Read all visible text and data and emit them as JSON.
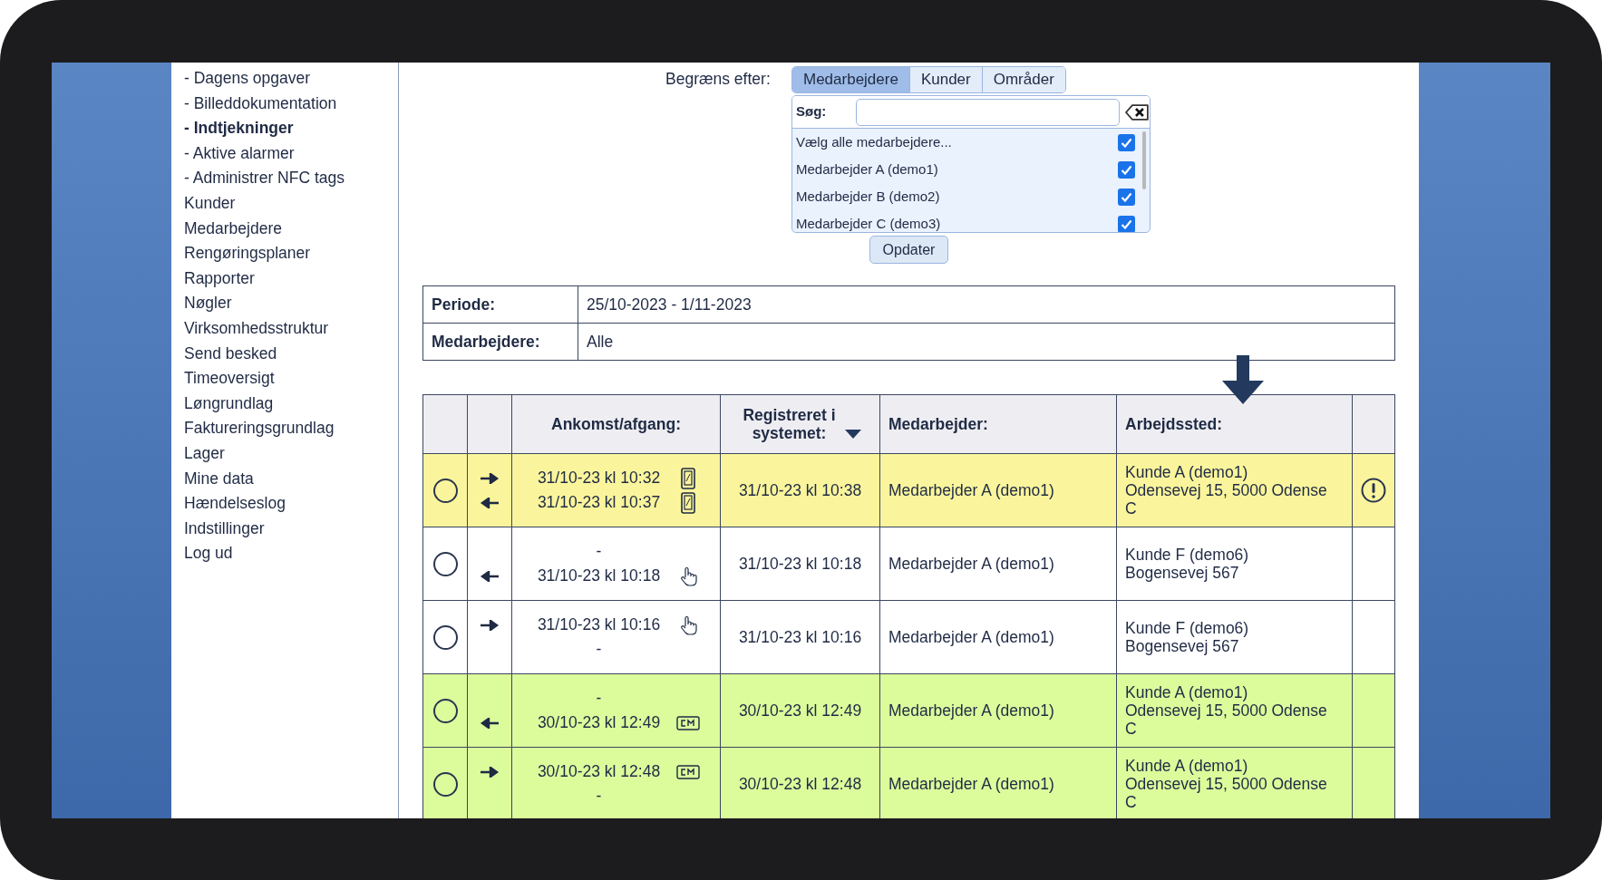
{
  "sidebar": {
    "items": [
      {
        "label": "- Dagens opgaver",
        "selected": false
      },
      {
        "label": "- Billeddokumentation",
        "selected": false
      },
      {
        "label": "- Indtjekninger",
        "selected": true
      },
      {
        "label": "- Aktive alarmer",
        "selected": false
      },
      {
        "label": "- Administrer NFC tags",
        "selected": false
      },
      {
        "label": "Kunder",
        "selected": false
      },
      {
        "label": "Medarbejdere",
        "selected": false
      },
      {
        "label": "Rengøringsplaner",
        "selected": false
      },
      {
        "label": "Rapporter",
        "selected": false
      },
      {
        "label": "Nøgler",
        "selected": false
      },
      {
        "label": "Virksomhedsstruktur",
        "selected": false
      },
      {
        "label": "Send besked",
        "selected": false
      },
      {
        "label": "Timeoversigt",
        "selected": false
      },
      {
        "label": "Løngrundlag",
        "selected": false
      },
      {
        "label": "Faktureringsgrundlag",
        "selected": false
      },
      {
        "label": "Lager",
        "selected": false
      },
      {
        "label": "Mine data",
        "selected": false
      },
      {
        "label": "Hændelseslog",
        "selected": false
      },
      {
        "label": "Indstillinger",
        "selected": false
      },
      {
        "label": "Log ud",
        "selected": false
      }
    ]
  },
  "filter": {
    "label": "Begræns efter:",
    "tabs": [
      {
        "label": "Medarbejdere",
        "selected": true
      },
      {
        "label": "Kunder",
        "selected": false
      },
      {
        "label": "Områder",
        "selected": false
      }
    ],
    "search_label": "Søg:",
    "options": [
      {
        "label": "Vælg alle medarbejdere...",
        "checked": true
      },
      {
        "label": "Medarbejder A (demo1)",
        "checked": true
      },
      {
        "label": "Medarbejder B (demo2)",
        "checked": true
      },
      {
        "label": "Medarbejder C (demo3)",
        "checked": true
      }
    ],
    "update_button": "Opdater"
  },
  "info": [
    {
      "label": "Periode:",
      "value": "25/10-2023 - 1/11-2023"
    },
    {
      "label": "Medarbejdere:",
      "value": "Alle"
    }
  ],
  "table": {
    "columns": [
      "Ankomst/afgang:",
      "Registreret i systemet:",
      "Medarbejder:",
      "Arbejdssted:"
    ],
    "rows": [
      {
        "color": "#faf59c",
        "selected": false,
        "alert": true,
        "arrival": {
          "time": "31/10-23 kl 10:32",
          "kind": "phone"
        },
        "departure": {
          "time": "31/10-23 kl 10:37",
          "kind": "phone"
        },
        "registered": "31/10-23 kl 10:38",
        "employee": "Medarbejder A (demo1)",
        "place": [
          "Kunde A (demo1)",
          "Odensevej 15, 5000 Odense C"
        ]
      },
      {
        "color": "#ffffff",
        "selected": false,
        "alert": false,
        "arrival": {
          "time": "-"
        },
        "departure": {
          "time": "31/10-23 kl 10:18",
          "kind": "manual"
        },
        "registered": "31/10-23 kl 10:18",
        "employee": "Medarbejder A (demo1)",
        "place": [
          "Kunde F (demo6)",
          "Bogensevej 567"
        ]
      },
      {
        "color": "#ffffff",
        "selected": false,
        "alert": false,
        "arrival": {
          "time": "31/10-23 kl 10:16",
          "kind": "manual"
        },
        "departure": {
          "time": "-"
        },
        "registered": "31/10-23 kl 10:16",
        "employee": "Medarbejder A (demo1)",
        "place": [
          "Kunde F (demo6)",
          "Bogensevej 567"
        ]
      },
      {
        "color": "#dcfc9c",
        "selected": false,
        "alert": false,
        "arrival": {
          "time": "-"
        },
        "departure": {
          "time": "30/10-23 kl 12:49",
          "kind": "cm"
        },
        "registered": "30/10-23 kl 12:49",
        "employee": "Medarbejder A (demo1)",
        "place": [
          "Kunde A (demo1)",
          "Odensevej 15, 5000 Odense C"
        ]
      },
      {
        "color": "#dcfc9c",
        "selected": false,
        "alert": false,
        "arrival": {
          "time": "30/10-23 kl 12:48",
          "kind": "cm"
        },
        "departure": {
          "time": "-"
        },
        "registered": "30/10-23 kl 12:48",
        "employee": "Medarbejder A (demo1)",
        "place": [
          "Kunde A (demo1)",
          "Odensevej 15, 5000 Odense C"
        ]
      }
    ]
  }
}
